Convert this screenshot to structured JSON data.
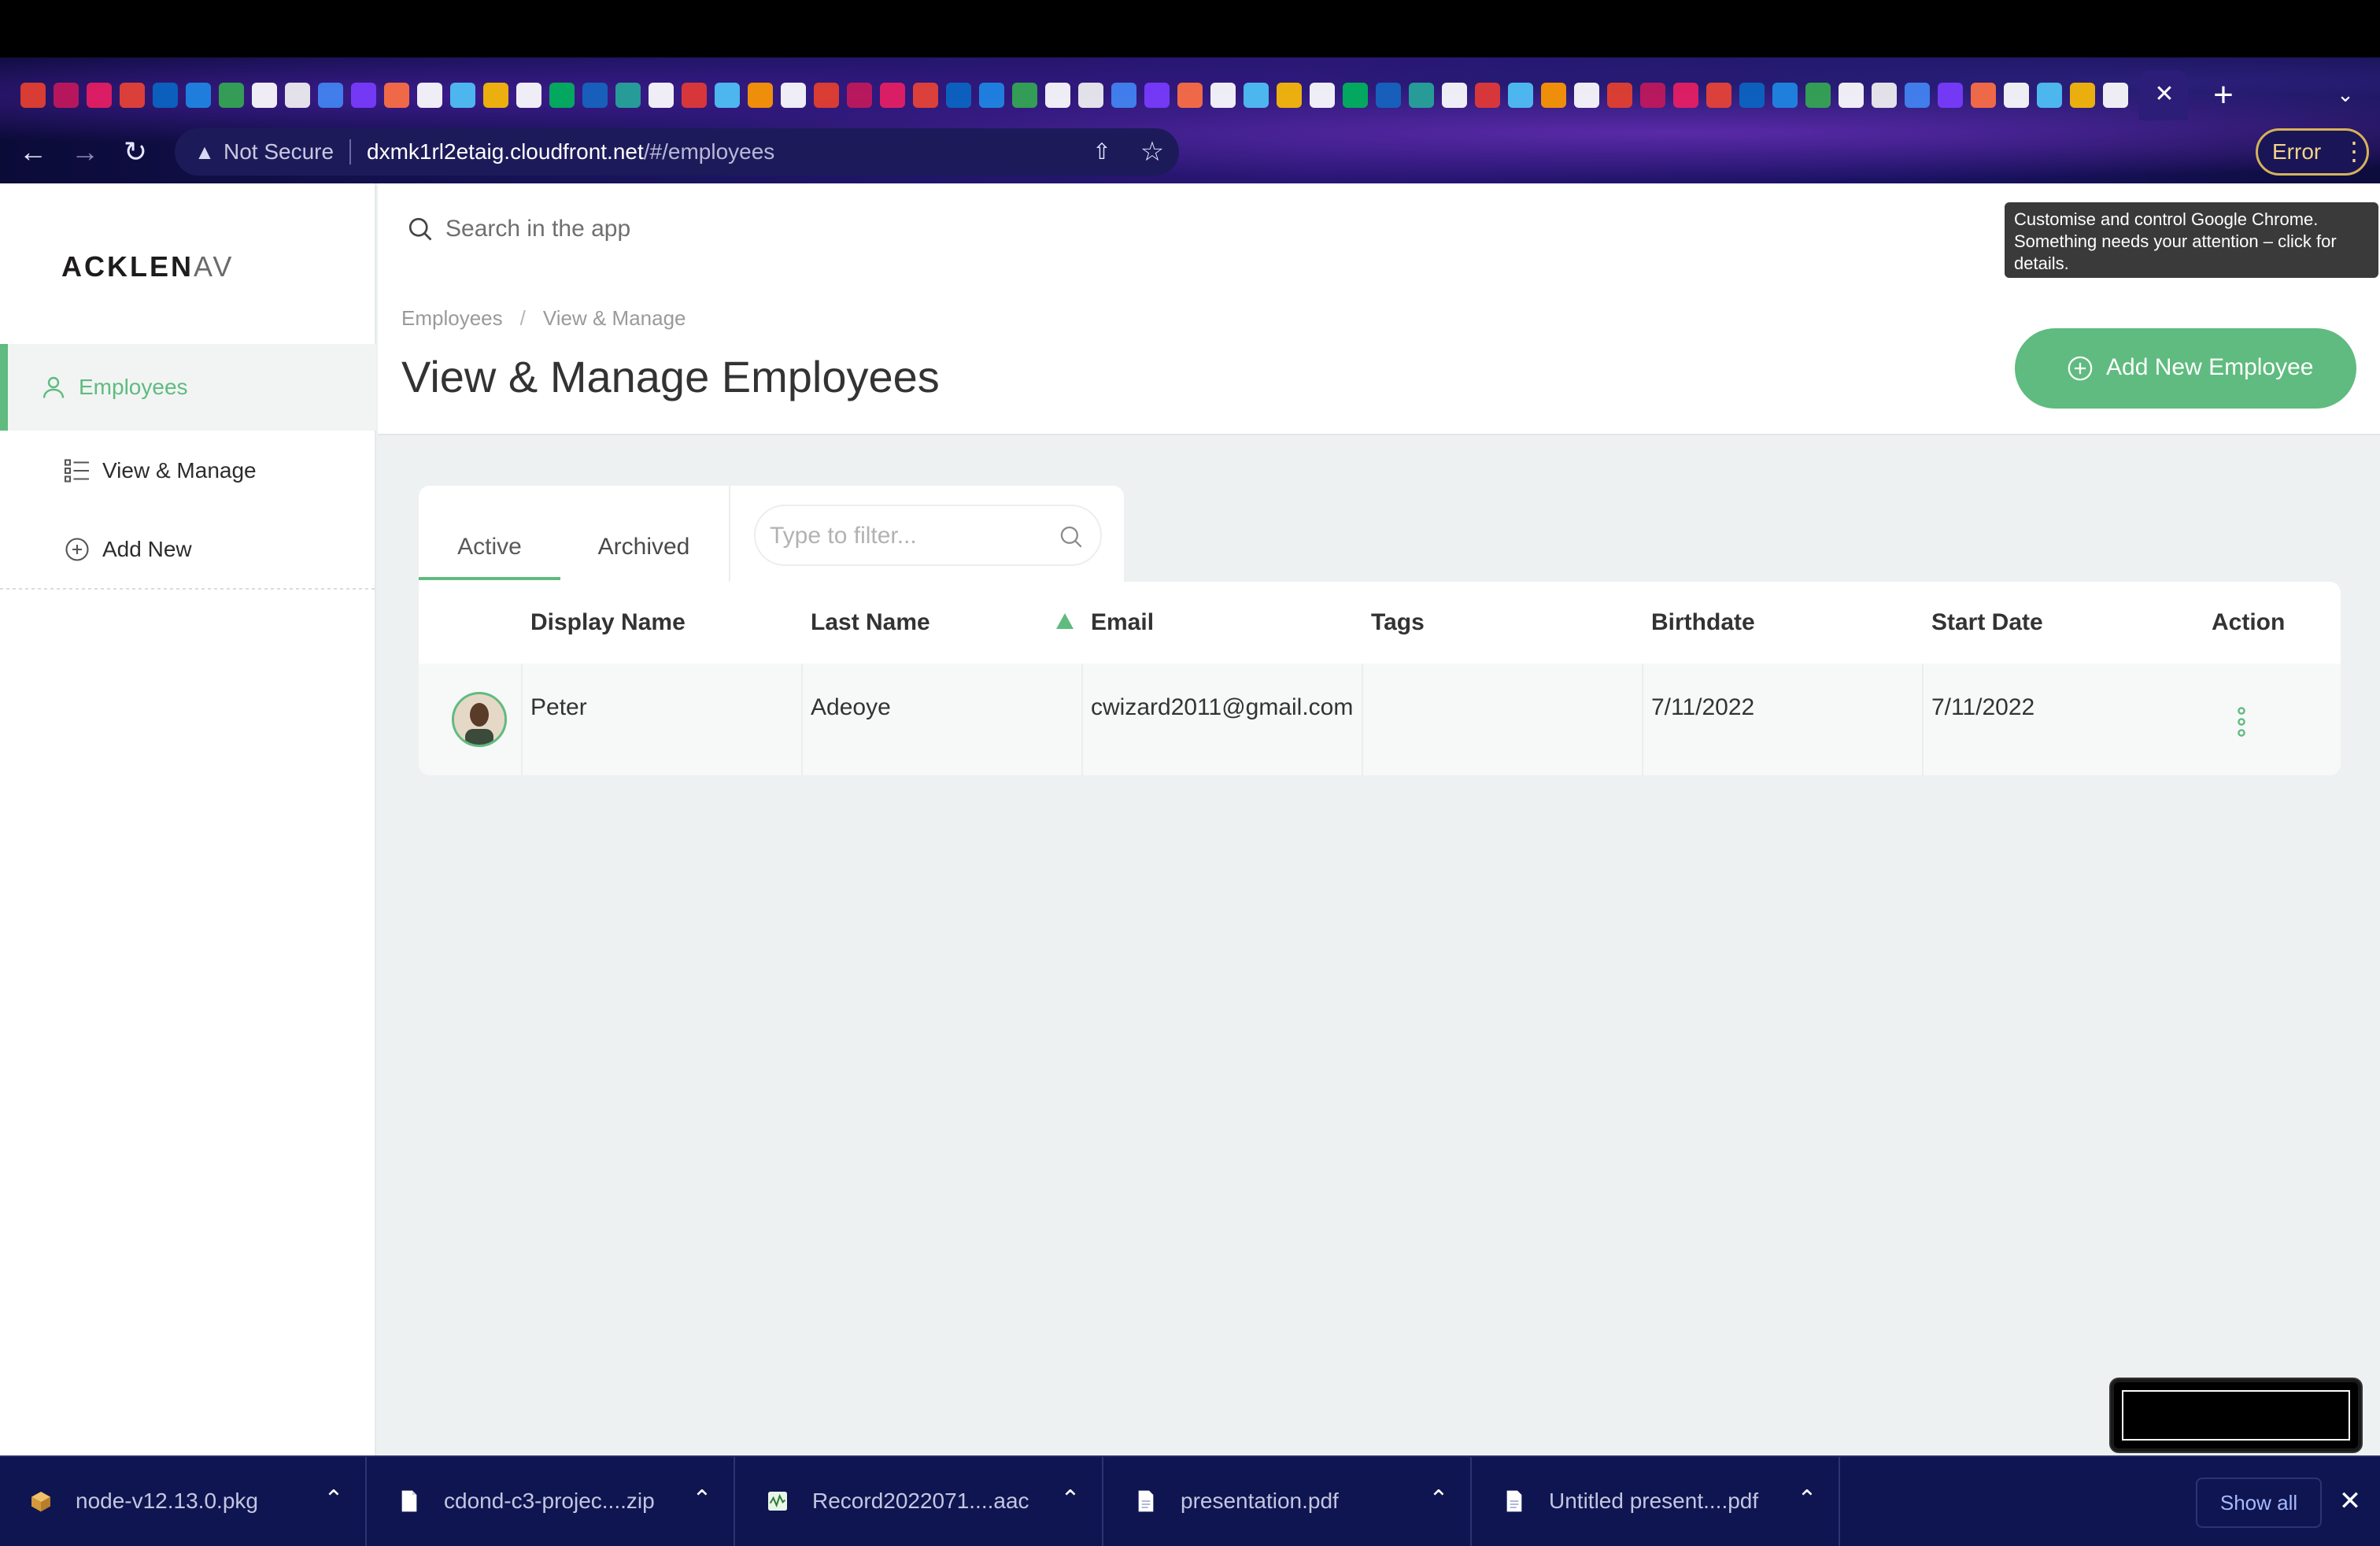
{
  "browser": {
    "url_warning": "Not Secure",
    "url_host": "dxmk1rl2etaig.cloudfront.net",
    "url_path": "/#/employees",
    "error_button": "Error",
    "new_tab": "+",
    "tooltip": "Customise and control Google Chrome. Something needs your attention – click for details."
  },
  "sidebar": {
    "logo_main": "ACKLEN",
    "logo_faded": "AV",
    "items": [
      {
        "label": "Employees"
      },
      {
        "label": "View & Manage"
      },
      {
        "label": "Add New"
      }
    ]
  },
  "header": {
    "search_placeholder": "Search in the app",
    "breadcrumbs": [
      "Employees",
      "View & Manage"
    ],
    "breadcrumb_sep": "/",
    "title": "View & Manage Employees",
    "add_button": "Add New Employee"
  },
  "tabs": {
    "active": "Active",
    "archived": "Archived",
    "filter_placeholder": "Type to filter..."
  },
  "table": {
    "columns": [
      "Display Name",
      "Last Name",
      "Email",
      "Tags",
      "Birthdate",
      "Start Date",
      "Action"
    ],
    "rows": [
      {
        "display_name": "Peter",
        "last_name": "Adeoye",
        "email": "cwizard2011@gmail.com",
        "tags": "",
        "birthdate": "7/11/2022",
        "start_date": "7/11/2022"
      }
    ]
  },
  "downloads": {
    "items": [
      "node-v12.13.0.pkg",
      "cdond-c3-projec....zip",
      "Record2022071....aac",
      "presentation.pdf",
      "Untitled present....pdf"
    ],
    "show_all": "Show all"
  },
  "colors": {
    "accent": "#5fbb7f",
    "background": "#eef1f1"
  }
}
